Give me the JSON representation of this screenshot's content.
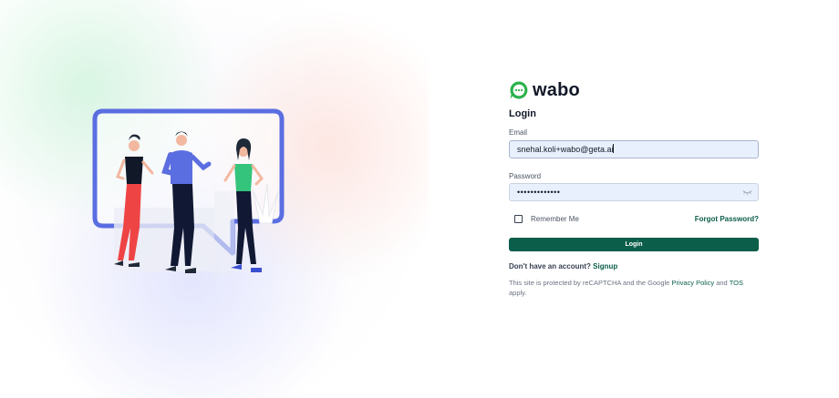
{
  "brand": {
    "name": "wabo",
    "color": "#2bb24c",
    "icon": "chat-bubble-icon"
  },
  "form": {
    "title": "Login",
    "email": {
      "label": "Email",
      "value": "snehal.koli+wabo@geta.ai"
    },
    "password": {
      "label": "Password",
      "masked_value": "•••••••••••••",
      "toggle_icon": "eye-closed-icon"
    },
    "remember_me": {
      "label": "Remember Me",
      "checked": false
    },
    "forgot_password": "Forgot Password?",
    "submit_label": "Login",
    "signup": {
      "prompt": "Don't have an account?",
      "link": "Signup"
    },
    "recaptcha": {
      "text_before": "This site is protected by reCAPTCHA and the Google",
      "privacy_link": "Privacy Policy",
      "and": "and",
      "tos_link": "TOS",
      "text_after": "apply."
    }
  },
  "colors": {
    "primary": "#0b5e4a",
    "input_bg": "#e9f0fd",
    "illustration_frame": "#5b6ee1"
  }
}
